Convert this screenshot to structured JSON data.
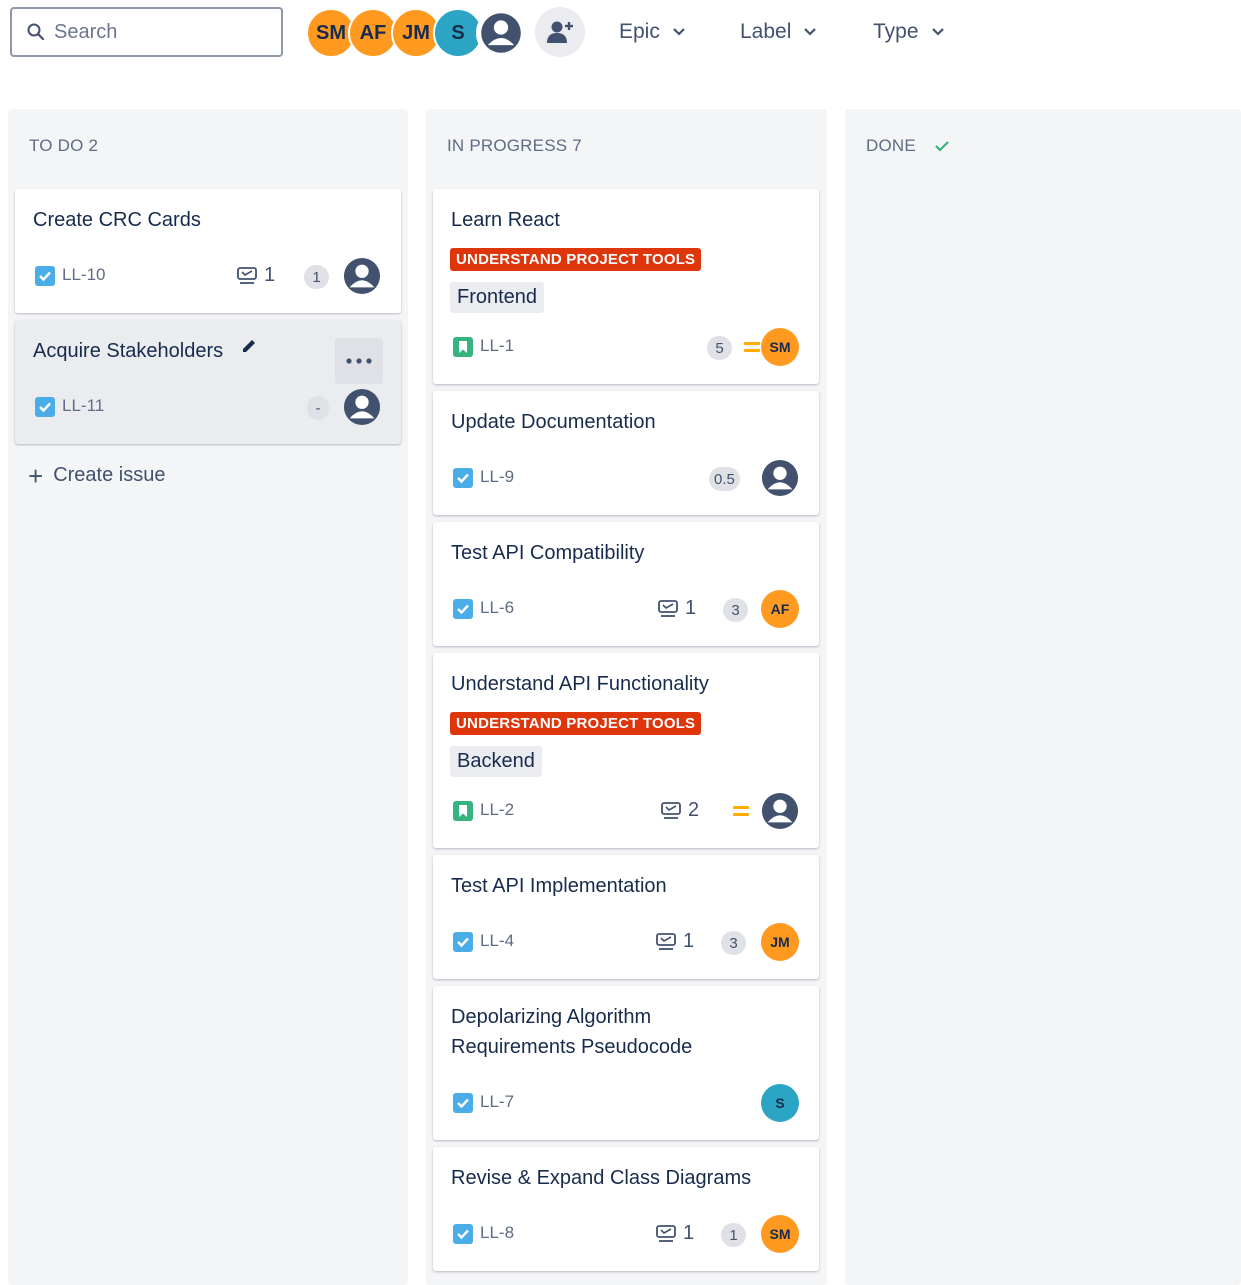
{
  "colors": {
    "avatar_orange": "#ff991f",
    "avatar_teal": "#2ba5c3",
    "epic_red": "#de350b",
    "story_green": "#36b37e",
    "task_blue": "#4bade8",
    "priority_medium": "#ffab00",
    "done_check": "#36b37e"
  },
  "toolbar": {
    "search_placeholder": "Search",
    "avatars": [
      {
        "initials": "SM",
        "color": "#ff991f"
      },
      {
        "initials": "AF",
        "color": "#ff991f"
      },
      {
        "initials": "JM",
        "color": "#ff991f"
      },
      {
        "initials": "S",
        "color": "#2ba5c3"
      },
      {
        "initials": "",
        "icon": "user-avatar-icon"
      }
    ],
    "add_people_icon": "add-user-icon",
    "filters": [
      {
        "label": "Epic",
        "icon": "chevron-down-icon"
      },
      {
        "label": "Label",
        "icon": "chevron-down-icon"
      },
      {
        "label": "Type",
        "icon": "chevron-down-icon"
      }
    ]
  },
  "board": {
    "columns": [
      {
        "title": "TO DO 2",
        "create_label": "Create issue",
        "cards": [
          {
            "title": "Create CRC Cards",
            "type": "task",
            "key": "LL-10",
            "subtasks": "1",
            "estimate": "1",
            "assignee": ""
          },
          {
            "title": "Acquire Stakeholders",
            "type": "task",
            "key": "LL-11",
            "estimate": "-",
            "assignee": "",
            "hovered": true
          }
        ]
      },
      {
        "title": "IN PROGRESS 7",
        "cards": [
          {
            "title": "Learn React",
            "epic": "UNDERSTAND PROJECT TOOLS",
            "label": "Frontend",
            "type": "story",
            "key": "LL-1",
            "estimate": "5",
            "priority": "medium",
            "assignee": "SM"
          },
          {
            "title": "Update Documentation",
            "type": "task",
            "key": "LL-9",
            "estimate": "0.5",
            "assignee": ""
          },
          {
            "title": "Test API Compatibility",
            "type": "task",
            "key": "LL-6",
            "subtasks": "1",
            "estimate": "3",
            "assignee": "AF"
          },
          {
            "title": "Understand API Functionality",
            "epic": "UNDERSTAND PROJECT TOOLS",
            "label": "Backend",
            "type": "story",
            "key": "LL-2",
            "subtasks": "2",
            "priority": "medium",
            "assignee": ""
          },
          {
            "title": "Test API Implementation",
            "type": "task",
            "key": "LL-4",
            "subtasks": "1",
            "estimate": "3",
            "assignee": "JM"
          },
          {
            "title_line1": "Depolarizing Algorithm",
            "title_line2": "Requirements Pseudocode",
            "type": "task",
            "key": "LL-7",
            "assignee": "S"
          },
          {
            "title": "Revise & Expand Class Diagrams",
            "type": "task",
            "key": "LL-8",
            "subtasks": "1",
            "estimate": "1",
            "assignee": "SM"
          }
        ]
      },
      {
        "title": "DONE",
        "status_icon": "check-icon",
        "cards": []
      }
    ]
  }
}
